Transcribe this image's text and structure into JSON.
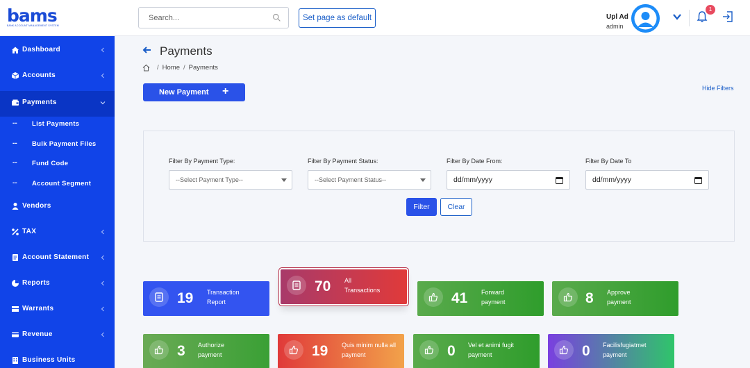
{
  "app": {
    "logo_text": "bams",
    "logo_subtext": "BANK ACCOUNT MANAGEMENT SYSTEM"
  },
  "header": {
    "search_placeholder": "Search...",
    "set_default_label": "Set page as default",
    "user_name": "Upl Ad",
    "user_role": "admin",
    "notification_count": "1"
  },
  "sidebar": {
    "items": [
      {
        "label": "Dashboard",
        "icon": "home-icon"
      },
      {
        "label": "Accounts",
        "icon": "box-icon"
      },
      {
        "label": "Payments",
        "icon": "wallet-icon"
      },
      {
        "label": "Vendors",
        "icon": "user-icon"
      },
      {
        "label": "TAX",
        "icon": "percent-icon"
      },
      {
        "label": "Account Statement",
        "icon": "document-icon"
      },
      {
        "label": "Reports",
        "icon": "chart-icon"
      },
      {
        "label": "Warrants",
        "icon": "layers-icon"
      },
      {
        "label": "Revenue",
        "icon": "credit-card-icon"
      },
      {
        "label": "Business Units",
        "icon": "building-icon"
      }
    ],
    "sub_dash": "--",
    "sub_items": [
      "List Payments",
      "Bulk Payment Files",
      "Fund Code",
      "Account Segment"
    ]
  },
  "main": {
    "title": "Payments",
    "breadcrumb": [
      "Home",
      "Payments"
    ],
    "breadcrumb_sep": "/",
    "new_payment_label": "New Payment",
    "new_payment_plus": "+",
    "hide_filters_label": "Hide Filters"
  },
  "filters": {
    "payment_type_label": "Filter By Payment Type:",
    "payment_type_value": "--Select Payment Type--",
    "payment_status_label": "Filter By Payment Status:",
    "payment_status_value": "--Select Payment Status--",
    "date_from_label": "Filter By Date From:",
    "date_from_value": "dd/mm/yyyy",
    "date_to_label": "Filter By Date To",
    "date_to_value": "dd/mm/yyyy",
    "filter_button": "Filter",
    "clear_button": "Clear"
  },
  "cards": [
    {
      "count": "19",
      "line1": "Transaction",
      "line2": "Report",
      "color": "#3354f0"
    },
    {
      "count": "70",
      "line1": "All",
      "line2": "Transactions",
      "color": "#c8334a"
    },
    {
      "count": "41",
      "line1": "Forward",
      "line2": "payment",
      "color": "#45a838"
    },
    {
      "count": "8",
      "line1": "Approve",
      "line2": "payment",
      "color": "#45a838"
    },
    {
      "count": "3",
      "line1": "Authorize",
      "line2": "payment",
      "color": "#55ab45"
    },
    {
      "count": "19",
      "line1": "Quis minim nulla all",
      "line2": "payment",
      "color": "#e0533a"
    },
    {
      "count": "0",
      "line1": "Vel et animi fugit",
      "line2": "payment",
      "color": "#45a838"
    },
    {
      "count": "0",
      "line1": "Facilisfugiatmet",
      "line2": "payment",
      "color": "#6a4ee0"
    }
  ]
}
